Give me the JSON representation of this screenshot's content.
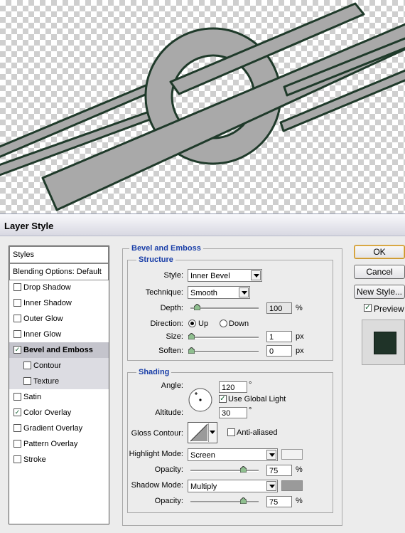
{
  "dialog": {
    "title": "Layer Style"
  },
  "left_panel": {
    "styles_header": "Styles",
    "blending_options": "Blending Options: Default",
    "items": [
      {
        "label": "Drop Shadow",
        "checked": false
      },
      {
        "label": "Inner Shadow",
        "checked": false
      },
      {
        "label": "Outer Glow",
        "checked": false
      },
      {
        "label": "Inner Glow",
        "checked": false
      },
      {
        "label": "Bevel and Emboss",
        "checked": true,
        "selected": true
      },
      {
        "label": "Contour",
        "checked": false,
        "sub": true
      },
      {
        "label": "Texture",
        "checked": false,
        "sub": true
      },
      {
        "label": "Satin",
        "checked": false
      },
      {
        "label": "Color Overlay",
        "checked": true
      },
      {
        "label": "Gradient Overlay",
        "checked": false
      },
      {
        "label": "Pattern Overlay",
        "checked": false
      },
      {
        "label": "Stroke",
        "checked": false
      }
    ]
  },
  "bevel": {
    "title": "Bevel and Emboss",
    "structure_title": "Structure",
    "style_label": "Style:",
    "style_value": "Inner Bevel",
    "technique_label": "Technique:",
    "technique_value": "Smooth",
    "depth_label": "Depth:",
    "depth_value": "100",
    "depth_unit": "%",
    "direction_label": "Direction:",
    "direction_up": "Up",
    "direction_down": "Down",
    "size_label": "Size:",
    "size_value": "1",
    "size_unit": "px",
    "soften_label": "Soften:",
    "soften_value": "0",
    "soften_unit": "px"
  },
  "shading": {
    "title": "Shading",
    "angle_label": "Angle:",
    "angle_value": "120",
    "angle_unit": "°",
    "use_global_light": "Use Global Light",
    "altitude_label": "Altitude:",
    "altitude_value": "30",
    "altitude_unit": "°",
    "gloss_contour_label": "Gloss Contour:",
    "anti_aliased": "Anti-aliased",
    "highlight_mode_label": "Highlight Mode:",
    "highlight_mode_value": "Screen",
    "highlight_color": "#ffffff",
    "highlight_opacity_label": "Opacity:",
    "highlight_opacity_value": "75",
    "highlight_opacity_unit": "%",
    "shadow_mode_label": "Shadow Mode:",
    "shadow_mode_value": "Multiply",
    "shadow_color": "#999999",
    "shadow_opacity_label": "Opacity:",
    "shadow_opacity_value": "75",
    "shadow_opacity_unit": "%"
  },
  "buttons": {
    "ok": "OK",
    "cancel": "Cancel",
    "new_style": "New Style...",
    "preview_label": "Preview"
  },
  "colors": {
    "shape_fill": "#a9a9a9",
    "shape_outline": "#1f3a2a",
    "preview_fill": "#1f3328",
    "group_title": "#1a3fa8"
  }
}
